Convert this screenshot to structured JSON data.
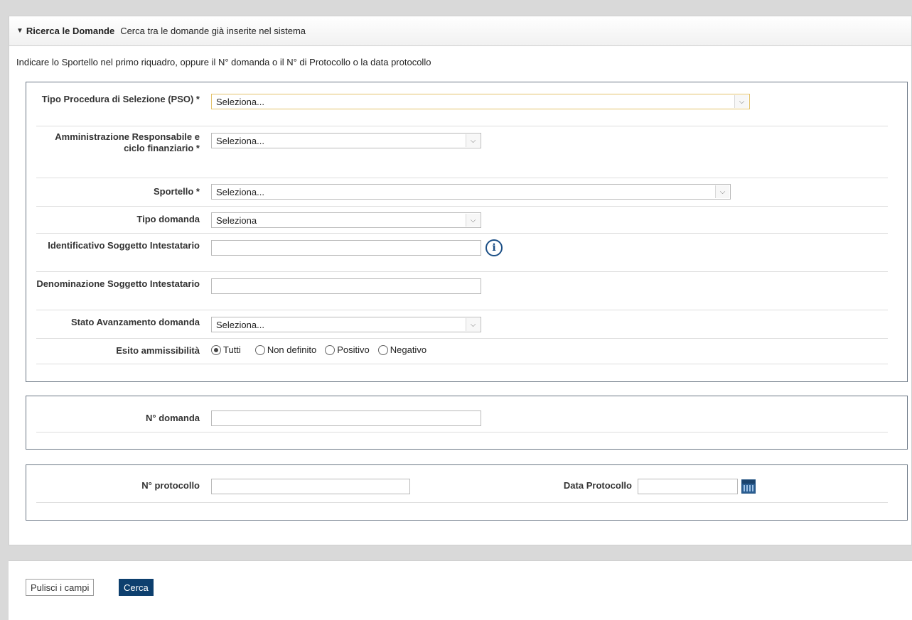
{
  "header": {
    "toggle_glyph": "▼",
    "title": "Ricerca le Domande",
    "subtitle": "Cerca tra le domande già inserite nel sistema"
  },
  "instruction": "Indicare lo Sportello nel primo riquadro, oppure il N° domanda o il N° di Protocollo o la data protocollo",
  "fields": {
    "tipo_procedura": {
      "label": "Tipo Procedura di Selezione (PSO) *",
      "value": "Seleziona..."
    },
    "amministrazione": {
      "label": "Amministrazione Responsabile e ciclo finanziario *",
      "value": "Seleziona..."
    },
    "sportello": {
      "label": "Sportello *",
      "value": "Seleziona..."
    },
    "tipo_domanda": {
      "label": "Tipo domanda",
      "value": "Seleziona"
    },
    "identificativo": {
      "label": "Identificativo Soggetto Intestatario",
      "value": ""
    },
    "denominazione": {
      "label": "Denominazione Soggetto Intestatario",
      "value": ""
    },
    "stato_avanzamento": {
      "label": "Stato Avanzamento domanda",
      "value": "Seleziona..."
    },
    "esito": {
      "label": "Esito ammissibilità",
      "options": [
        "Tutti",
        "Non definito",
        "Positivo",
        "Negativo"
      ],
      "selected": "Tutti"
    },
    "n_domanda": {
      "label": "N° domanda",
      "value": ""
    },
    "n_protocollo": {
      "label": "N° protocollo",
      "value": ""
    },
    "data_protocollo": {
      "label": "Data Protocollo",
      "value": ""
    }
  },
  "buttons": {
    "clear": "Pulisci i campi",
    "search": "Cerca"
  },
  "icons": {
    "dropdown": "chevron-down-icon",
    "info": "info-icon",
    "calendar": "calendar-icon"
  },
  "colors": {
    "primary_button": "#0d3f6e",
    "info_icon": "#1c4f86",
    "focus_border": "#e3c26a"
  }
}
